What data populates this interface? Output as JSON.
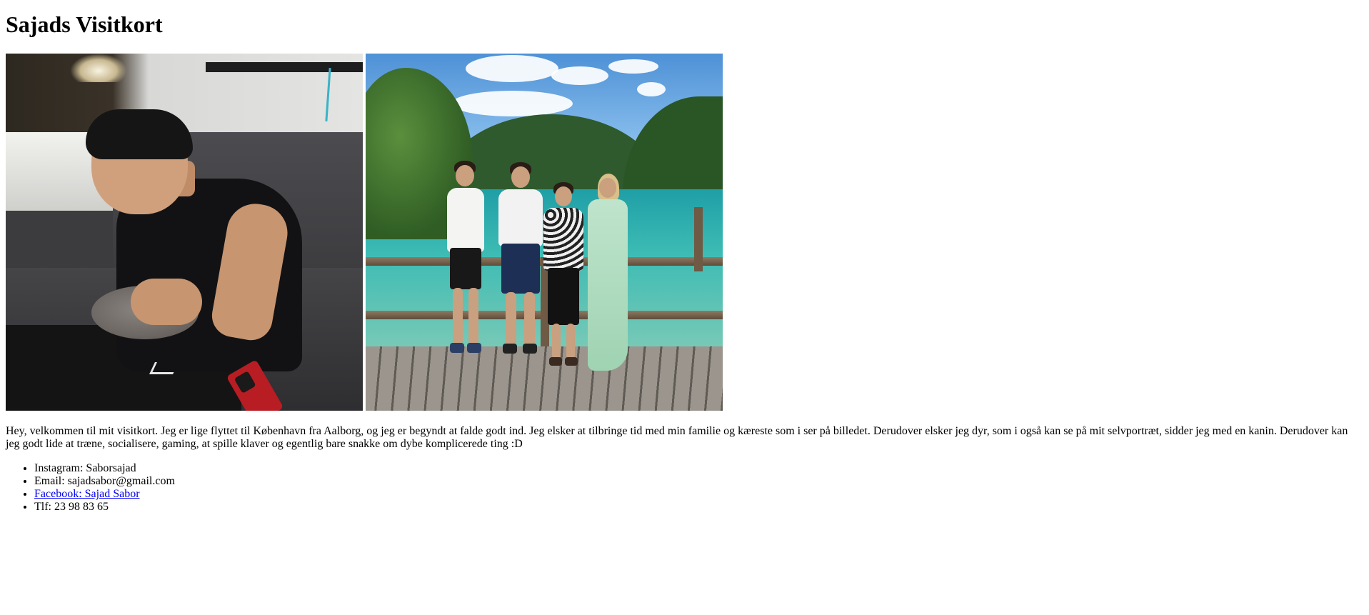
{
  "page": {
    "title": "Sajads Visitkort"
  },
  "photos": {
    "portrait_alt": "selvportræt med kanin",
    "lake_alt": "familie og kæreste ved søen"
  },
  "intro": {
    "text": "Hey, velkommen til mit visitkort. Jeg er lige flyttet til København fra Aalborg, og jeg er begyndt at falde godt ind. Jeg elsker at tilbringe tid med min familie og kæreste som i ser på billedet. Derudover elsker jeg dyr, som i også kan se på mit selvportræt, sidder jeg med en kanin. Derudover kan jeg godt lide at træne, socialisere, gaming, at spille klaver og egentlig bare snakke om dybe komplicerede ting :D"
  },
  "contacts": {
    "instagram": "Instagram: Saborsajad",
    "email": "Email: sajadsabor@gmail.com",
    "facebook": "Facebook: Sajad Sabor",
    "phone": "Tlf: 23 98 83 65"
  },
  "colors": {
    "link": "#0000ee",
    "text": "#000000",
    "background": "#ffffff"
  }
}
